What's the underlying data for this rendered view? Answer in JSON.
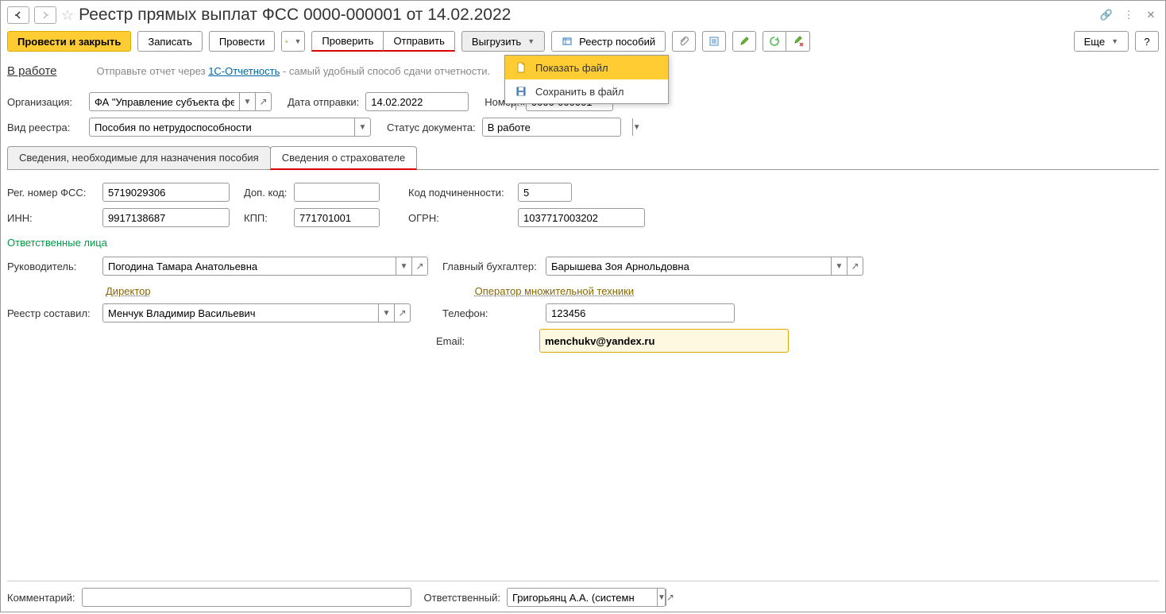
{
  "title": "Реестр прямых выплат ФСС 0000-000001 от 14.02.2022",
  "toolbar": {
    "post_close": "Провести и закрыть",
    "write": "Записать",
    "post": "Провести",
    "check": "Проверить",
    "send": "Отправить",
    "export": "Выгрузить",
    "registry": "Реестр пособий",
    "more": "Еще"
  },
  "menu": {
    "show_file": "Показать файл",
    "save_file": "Сохранить в файл"
  },
  "infobar": {
    "status": "В работе",
    "prefix": "Отправьте отчет через ",
    "link": "1С-Отчетность",
    "suffix": " - самый удобный способ сдачи отчетности."
  },
  "filters": {
    "org_label": "Организация:",
    "org_value": "ФА \"Управление субъекта федерац",
    "date_label": "Дата отправки:",
    "date_value": "14.02.2022",
    "number_label": "Номер:",
    "number_value": "0000-000001",
    "type_label": "Вид реестра:",
    "type_value": "Пособия по нетрудоспособности",
    "status_label": "Статус документа:",
    "status_value": "В работе"
  },
  "tabs": {
    "tab1": "Сведения, необходимые для назначения пособия",
    "tab2": "Сведения о страхователе"
  },
  "insurer": {
    "reg_label": "Рег. номер ФСС:",
    "reg_value": "5719029306",
    "dop_label": "Доп. код:",
    "dop_value": "",
    "sub_label": "Код подчиненности:",
    "sub_value": "5",
    "inn_label": "ИНН:",
    "inn_value": "9917138687",
    "kpp_label": "КПП:",
    "kpp_value": "771701001",
    "ogrn_label": "ОГРН:",
    "ogrn_value": "1037717003202"
  },
  "persons": {
    "section": "Ответственные лица",
    "head_label": "Руководитель:",
    "head_value": "Погодина Тамара Анатольевна",
    "head_role": "Директор",
    "accountant_label": "Главный бухгалтер:",
    "accountant_value": "Барышева Зоя Арнольдовна",
    "accountant_role": "Оператор множительной техники",
    "author_label": "Реестр составил:",
    "author_value": "Менчук Владимир Васильевич",
    "phone_label": "Телефон:",
    "phone_value": "123456",
    "email_label": "Email:",
    "email_value": "menchukv@yandex.ru"
  },
  "footer": {
    "comment_label": "Комментарий:",
    "comment_value": "",
    "responsible_label": "Ответственный:",
    "responsible_value": "Григорьянц А.А. (системн"
  }
}
